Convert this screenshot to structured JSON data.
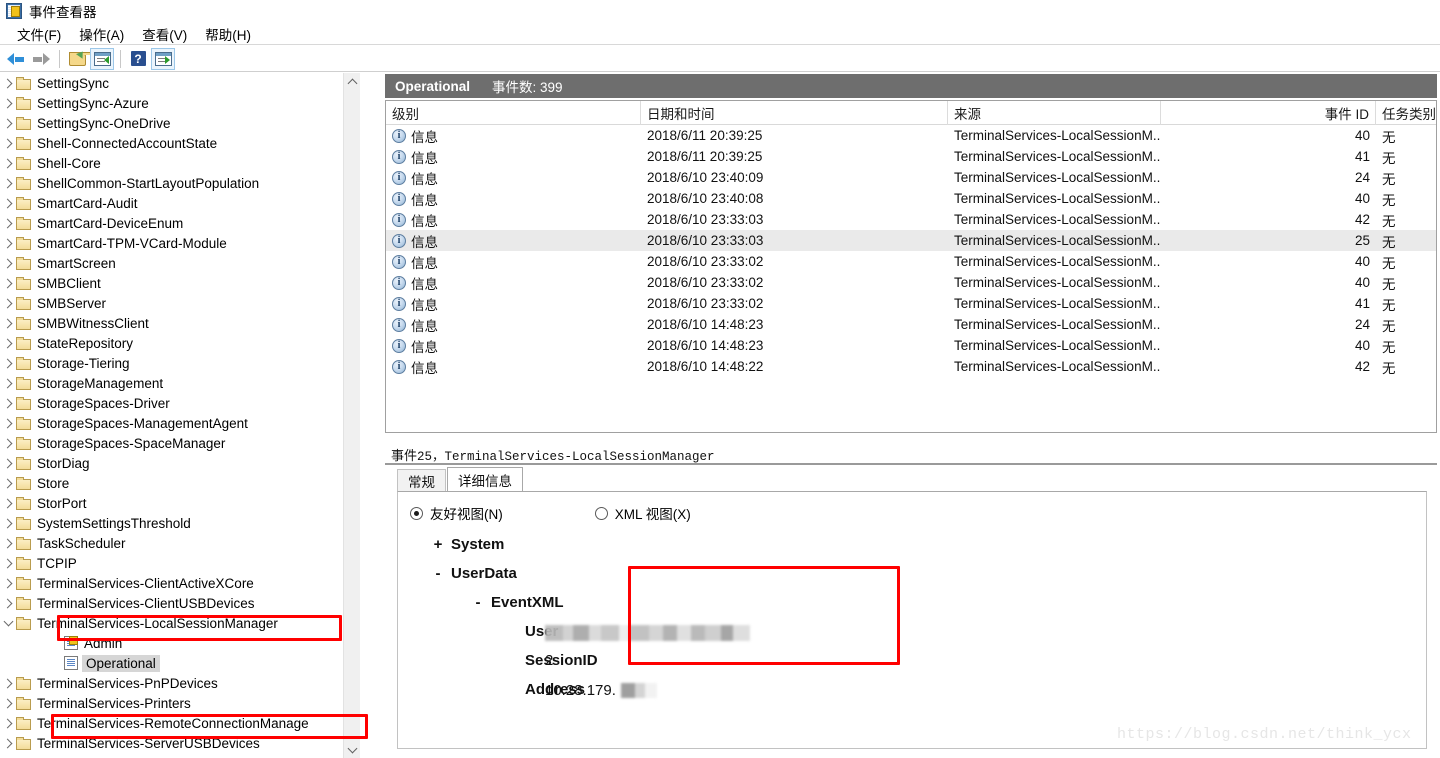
{
  "window": {
    "title": "事件查看器",
    "icon": "event-viewer-icon"
  },
  "menu": {
    "items": [
      {
        "label": "文件(F)"
      },
      {
        "label": "操作(A)"
      },
      {
        "label": "查看(V)"
      },
      {
        "label": "帮助(H)"
      }
    ]
  },
  "toolbar": {
    "buttons": [
      {
        "name": "back-icon",
        "label": ""
      },
      {
        "name": "forward-icon",
        "label": ""
      },
      {
        "name": "open-folder-icon",
        "label": ""
      },
      {
        "name": "show-action-pane-icon",
        "label": ""
      },
      {
        "name": "help-icon",
        "label": "?"
      },
      {
        "name": "show-preview-pane-icon",
        "label": ""
      }
    ]
  },
  "tree": {
    "items": [
      {
        "label": "SettingSync",
        "type": "folder",
        "expander": "collapsed",
        "indent": 0
      },
      {
        "label": "SettingSync-Azure",
        "type": "folder",
        "expander": "collapsed",
        "indent": 0
      },
      {
        "label": "SettingSync-OneDrive",
        "type": "folder",
        "expander": "collapsed",
        "indent": 0
      },
      {
        "label": "Shell-ConnectedAccountState",
        "type": "folder",
        "expander": "collapsed",
        "indent": 0
      },
      {
        "label": "Shell-Core",
        "type": "folder",
        "expander": "collapsed",
        "indent": 0
      },
      {
        "label": "ShellCommon-StartLayoutPopulation",
        "type": "folder",
        "expander": "collapsed",
        "indent": 0
      },
      {
        "label": "SmartCard-Audit",
        "type": "folder",
        "expander": "collapsed",
        "indent": 0
      },
      {
        "label": "SmartCard-DeviceEnum",
        "type": "folder",
        "expander": "collapsed",
        "indent": 0
      },
      {
        "label": "SmartCard-TPM-VCard-Module",
        "type": "folder",
        "expander": "collapsed",
        "indent": 0
      },
      {
        "label": "SmartScreen",
        "type": "folder",
        "expander": "collapsed",
        "indent": 0
      },
      {
        "label": "SMBClient",
        "type": "folder",
        "expander": "collapsed",
        "indent": 0
      },
      {
        "label": "SMBServer",
        "type": "folder",
        "expander": "collapsed",
        "indent": 0
      },
      {
        "label": "SMBWitnessClient",
        "type": "folder",
        "expander": "collapsed",
        "indent": 0
      },
      {
        "label": "StateRepository",
        "type": "folder",
        "expander": "collapsed",
        "indent": 0
      },
      {
        "label": "Storage-Tiering",
        "type": "folder",
        "expander": "collapsed",
        "indent": 0
      },
      {
        "label": "StorageManagement",
        "type": "folder",
        "expander": "collapsed",
        "indent": 0
      },
      {
        "label": "StorageSpaces-Driver",
        "type": "folder",
        "expander": "collapsed",
        "indent": 0
      },
      {
        "label": "StorageSpaces-ManagementAgent",
        "type": "folder",
        "expander": "collapsed",
        "indent": 0
      },
      {
        "label": "StorageSpaces-SpaceManager",
        "type": "folder",
        "expander": "collapsed",
        "indent": 0
      },
      {
        "label": "StorDiag",
        "type": "folder",
        "expander": "collapsed",
        "indent": 0
      },
      {
        "label": "Store",
        "type": "folder",
        "expander": "collapsed",
        "indent": 0
      },
      {
        "label": "StorPort",
        "type": "folder",
        "expander": "collapsed",
        "indent": 0
      },
      {
        "label": "SystemSettingsThreshold",
        "type": "folder",
        "expander": "collapsed",
        "indent": 0
      },
      {
        "label": "TaskScheduler",
        "type": "folder",
        "expander": "collapsed",
        "indent": 0
      },
      {
        "label": "TCPIP",
        "type": "folder",
        "expander": "collapsed",
        "indent": 0
      },
      {
        "label": "TerminalServices-ClientActiveXCore",
        "type": "folder",
        "expander": "collapsed",
        "indent": 0
      },
      {
        "label": "TerminalServices-ClientUSBDevices",
        "type": "folder",
        "expander": "collapsed",
        "indent": 0
      },
      {
        "label": "TerminalServices-LocalSessionManager",
        "type": "folder",
        "expander": "expanded",
        "indent": 0,
        "highlighted": true
      },
      {
        "label": "Admin",
        "type": "log-admin",
        "expander": "none",
        "indent": 2
      },
      {
        "label": "Operational",
        "type": "log",
        "expander": "none",
        "indent": 2,
        "selected": true
      },
      {
        "label": "TerminalServices-PnPDevices",
        "type": "folder",
        "expander": "collapsed",
        "indent": 0
      },
      {
        "label": "TerminalServices-Printers",
        "type": "folder",
        "expander": "collapsed",
        "indent": 0
      },
      {
        "label": "TerminalServices-RemoteConnectionManage",
        "type": "folder",
        "expander": "collapsed",
        "indent": 0,
        "highlighted": true
      },
      {
        "label": "TerminalServices-ServerUSBDevices",
        "type": "folder",
        "expander": "collapsed",
        "indent": 0
      }
    ]
  },
  "log_header": {
    "name": "Operational",
    "count_label": "事件数: 399"
  },
  "event_list": {
    "columns": [
      {
        "key": "level",
        "label": "级别"
      },
      {
        "key": "datetime",
        "label": "日期和时间"
      },
      {
        "key": "source",
        "label": "来源"
      },
      {
        "key": "event_id",
        "label": "事件 ID"
      },
      {
        "key": "task",
        "label": "任务类别"
      }
    ],
    "rows": [
      {
        "level": "信息",
        "datetime": "2018/6/11 20:39:25",
        "source": "TerminalServices-LocalSessionM...",
        "event_id": "40",
        "task": "无",
        "selected": false
      },
      {
        "level": "信息",
        "datetime": "2018/6/11 20:39:25",
        "source": "TerminalServices-LocalSessionM...",
        "event_id": "41",
        "task": "无",
        "selected": false
      },
      {
        "level": "信息",
        "datetime": "2018/6/10 23:40:09",
        "source": "TerminalServices-LocalSessionM...",
        "event_id": "24",
        "task": "无",
        "selected": false
      },
      {
        "level": "信息",
        "datetime": "2018/6/10 23:40:08",
        "source": "TerminalServices-LocalSessionM...",
        "event_id": "40",
        "task": "无",
        "selected": false
      },
      {
        "level": "信息",
        "datetime": "2018/6/10 23:33:03",
        "source": "TerminalServices-LocalSessionM...",
        "event_id": "42",
        "task": "无",
        "selected": false
      },
      {
        "level": "信息",
        "datetime": "2018/6/10 23:33:03",
        "source": "TerminalServices-LocalSessionM...",
        "event_id": "25",
        "task": "无",
        "selected": true
      },
      {
        "level": "信息",
        "datetime": "2018/6/10 23:33:02",
        "source": "TerminalServices-LocalSessionM...",
        "event_id": "40",
        "task": "无",
        "selected": false
      },
      {
        "level": "信息",
        "datetime": "2018/6/10 23:33:02",
        "source": "TerminalServices-LocalSessionM...",
        "event_id": "40",
        "task": "无",
        "selected": false
      },
      {
        "level": "信息",
        "datetime": "2018/6/10 23:33:02",
        "source": "TerminalServices-LocalSessionM...",
        "event_id": "41",
        "task": "无",
        "selected": false
      },
      {
        "level": "信息",
        "datetime": "2018/6/10 14:48:23",
        "source": "TerminalServices-LocalSessionM...",
        "event_id": "24",
        "task": "无",
        "selected": false
      },
      {
        "level": "信息",
        "datetime": "2018/6/10 14:48:23",
        "source": "TerminalServices-LocalSessionM...",
        "event_id": "40",
        "task": "无",
        "selected": false
      },
      {
        "level": "信息",
        "datetime": "2018/6/10 14:48:22",
        "source": "TerminalServices-LocalSessionM...",
        "event_id": "42",
        "task": "无",
        "selected": false
      }
    ]
  },
  "detail": {
    "title_prefix": "事件",
    "title_text": " 25，TerminalServices-LocalSessionManager",
    "tabs": [
      {
        "label": "常规",
        "active": false
      },
      {
        "label": "详细信息",
        "active": true
      }
    ],
    "view_options": [
      {
        "label": "友好视图(N)",
        "selected": true
      },
      {
        "label": "XML 视图(X)",
        "selected": false
      }
    ],
    "xml_tree": [
      {
        "sign": "+",
        "key": "System",
        "value": "",
        "level": 1
      },
      {
        "sign": "-",
        "key": "UserData",
        "value": "",
        "level": 1
      },
      {
        "sign": "-",
        "key": "EventXML",
        "value": "",
        "level": 2
      },
      {
        "sign": "",
        "key": "User",
        "value": "",
        "level": 3,
        "redacted": "user"
      },
      {
        "sign": "",
        "key": "SessionID",
        "value": "2",
        "level": 3
      },
      {
        "sign": "",
        "key": "Address",
        "value": "10.28.179.",
        "level": 3,
        "redacted": "ip"
      }
    ]
  },
  "watermark": {
    "text": "https://blog.csdn.net/think_ycx"
  },
  "colors": {
    "header_bar": "#6e6e6e",
    "highlight_red": "#ff0000",
    "selection_gray": "#eaeaea",
    "tree_selection": "#d6d6d6"
  }
}
